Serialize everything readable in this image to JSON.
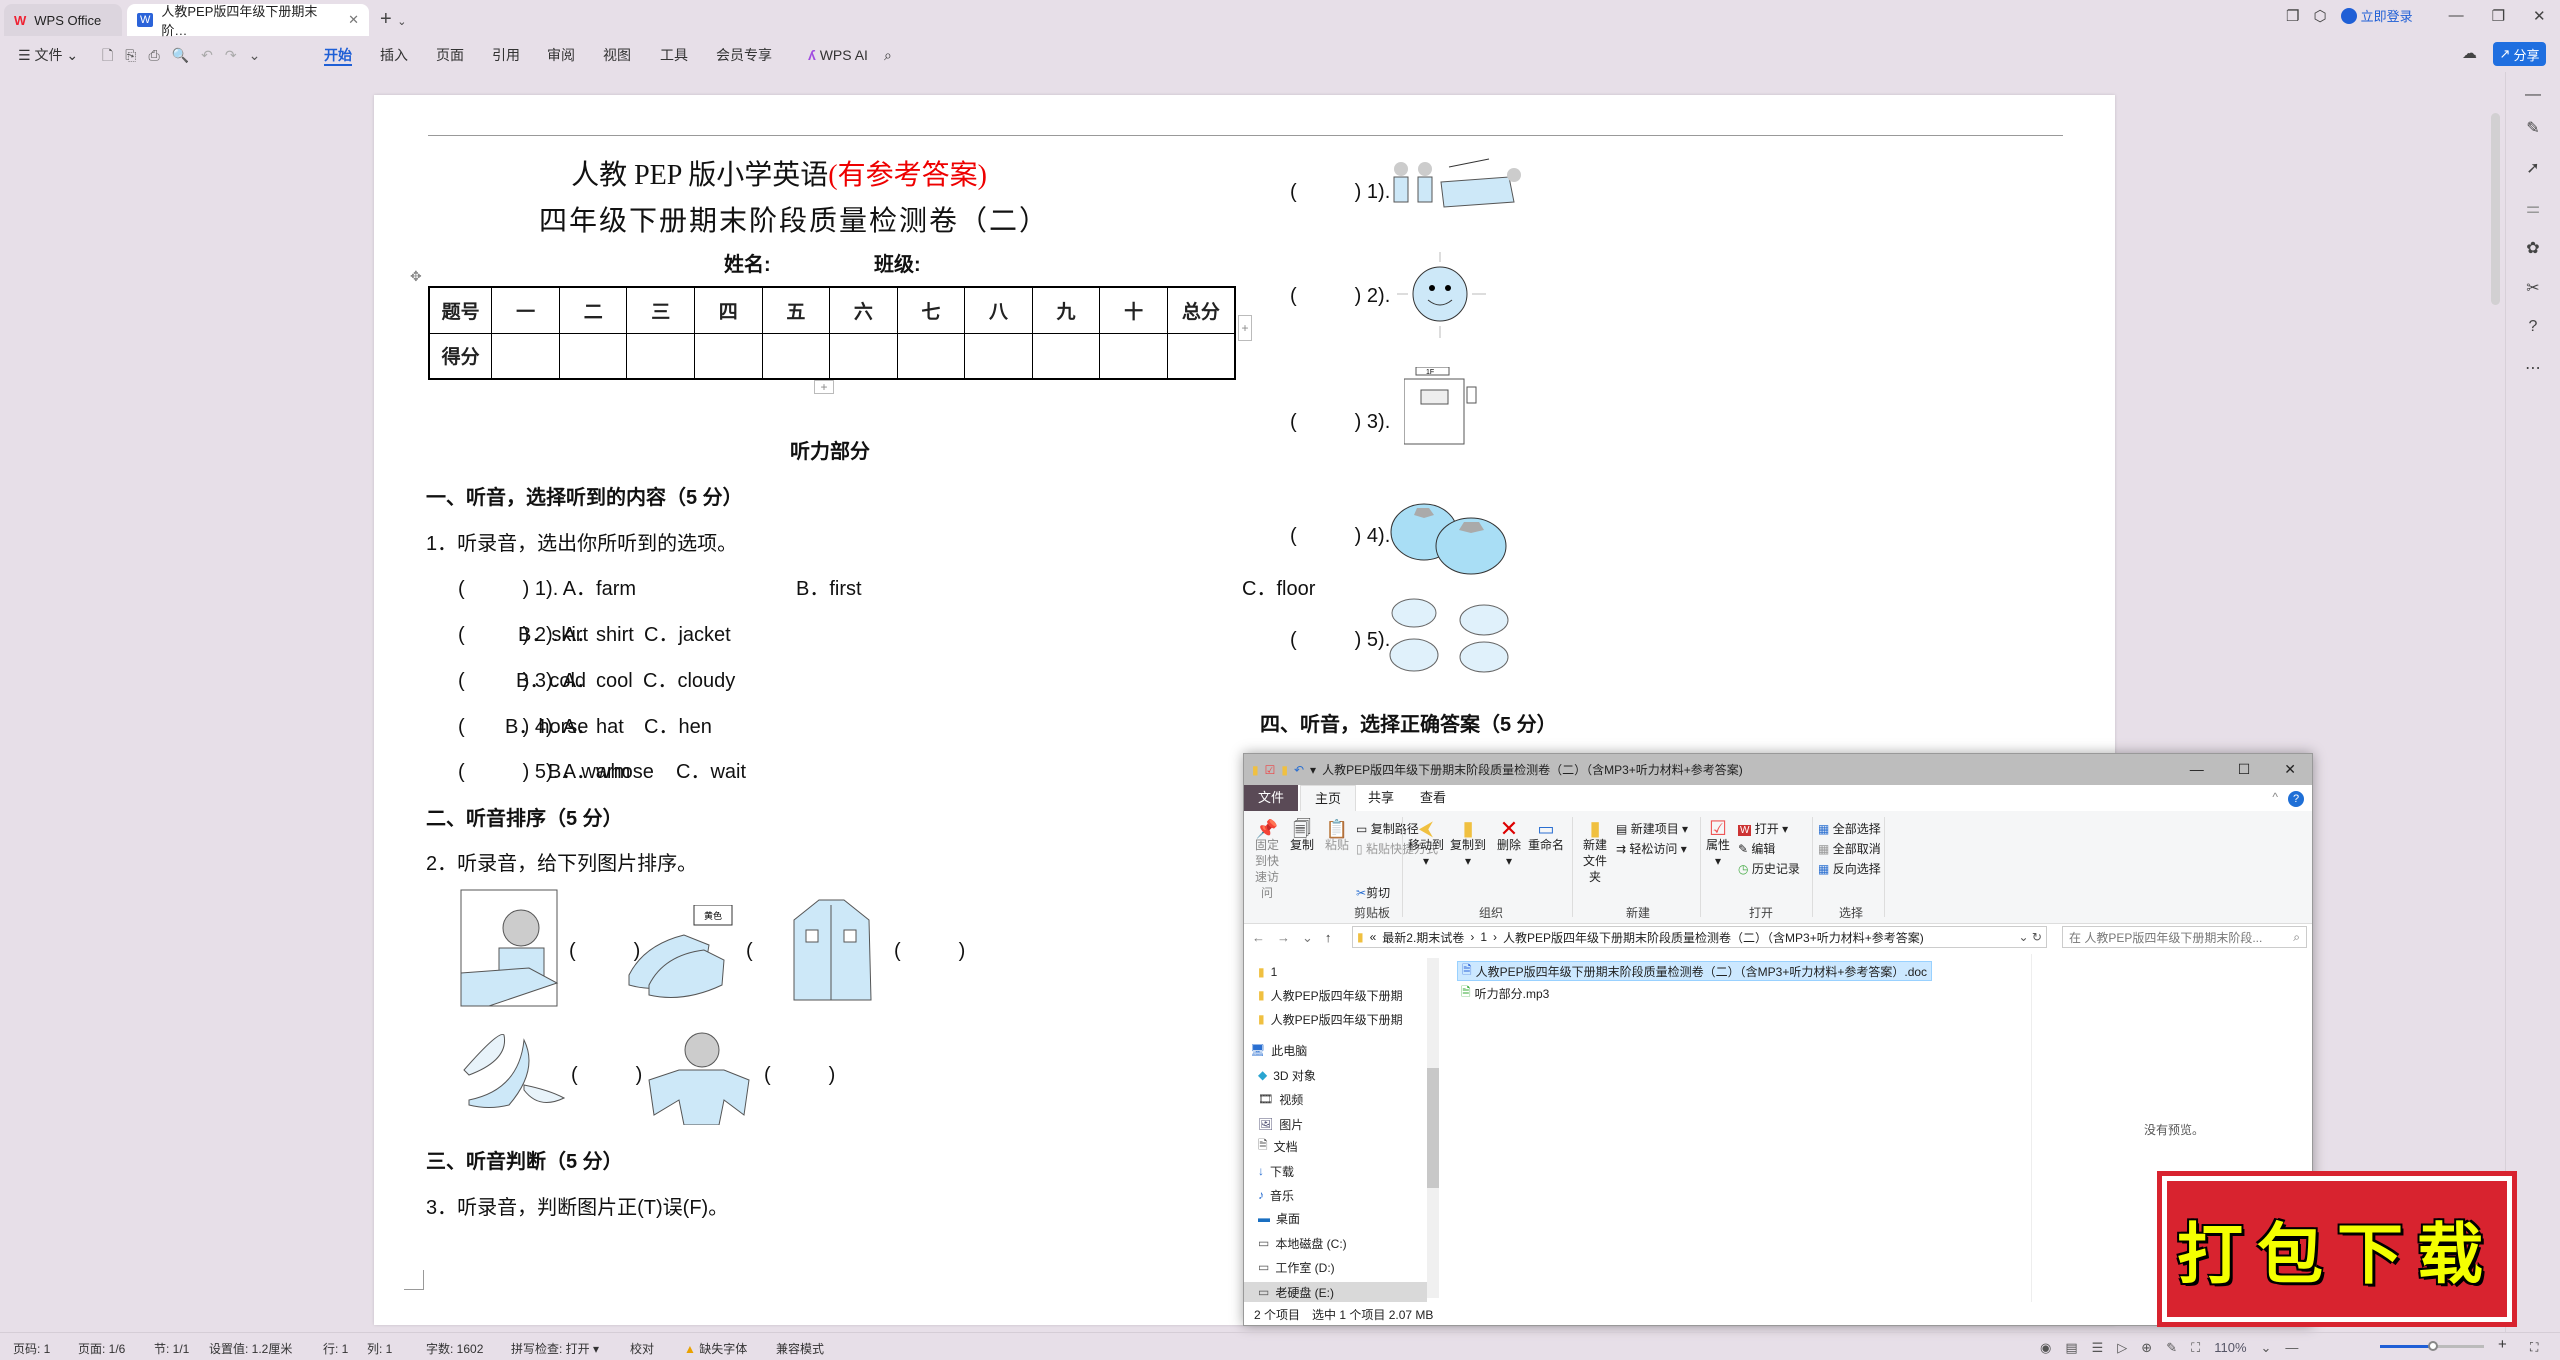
{
  "app": {
    "home_tab": "WPS Office",
    "doc_tab": "人教PEP版四年级下册期末阶…",
    "login": "立即登录",
    "share": "分享"
  },
  "menu": {
    "file": "文件",
    "tabs": [
      "开始",
      "插入",
      "页面",
      "引用",
      "审阅",
      "视图",
      "工具",
      "会员专享"
    ],
    "ai": "WPS AI",
    "active": "开始",
    "accent": "#1f5fd6"
  },
  "doc": {
    "title1": "人教 PEP 版小学英语",
    "title1_red": "(有参考答案)",
    "title2": "四年级下册期末阶段质量检测卷（二）",
    "name_label": "姓名:",
    "class_label": "班级:",
    "table_header": [
      "题号",
      "一",
      "二",
      "三",
      "四",
      "五",
      "六",
      "七",
      "八",
      "九",
      "十",
      "总分"
    ],
    "table_row2": "得分",
    "listening": "听力部分",
    "s1": "一、听音，选择听到的内容（5 分）",
    "q1": "1．听录音，选出你所听到的选项。",
    "q1_items": [
      {
        "n": "1). A．farm",
        "b": "B．first",
        "c": "C．floor"
      },
      {
        "n": "2). A．shirt",
        "b": "B．skirt",
        "c": "C．jacket"
      },
      {
        "n": "3). A．cool",
        "b": "B．cold",
        "c": "C．cloudy"
      },
      {
        "n": "4). A．hat",
        "b": "B．horse",
        "c": "C．hen"
      },
      {
        "n": "5). A．whose",
        "b": "B．warm",
        "c": "C．wait"
      }
    ],
    "s2": "二、听音排序（5 分）",
    "q2": "2．听录音，给下列图片排序。",
    "shoe_tag": "黄色",
    "s3": "三、听音判断（5 分）",
    "q3": "3．听录音，判断图片正(T)误(F)。",
    "right_items": [
      "1).",
      "2).",
      "3).",
      "4).",
      "5)."
    ],
    "elevator_sign": "1F",
    "s4": "四、听音，选择正确答案（5 分）",
    "paren_open": "(",
    "paren_close": ")"
  },
  "explorer": {
    "title": "人教PEP版四年级下册期末阶段质量检测卷（二）（含MP3+听力材料+参考答案)",
    "tabs": [
      "文件",
      "主页",
      "共享",
      "查看"
    ],
    "ribbon": {
      "pin": "固定到快速访问",
      "copy": "复制",
      "paste": "粘贴",
      "copy_path": "复制路径",
      "paste_shortcut": "粘贴快捷方式",
      "cut": "剪切",
      "clipboard": "剪贴板",
      "move_to": "移动到",
      "copy_to": "复制到",
      "delete": "删除",
      "rename": "重命名",
      "organize": "组织",
      "new_folder": "新建文件夹",
      "new_item": "新建项目",
      "easy_access": "轻松访问",
      "new": "新建",
      "properties": "属性",
      "open": "打开",
      "edit": "编辑",
      "history": "历史记录",
      "open_group": "打开",
      "select_all": "全部选择",
      "select_none": "全部取消",
      "invert": "反向选择",
      "select": "选择"
    },
    "breadcrumb": [
      "«",
      "最新2.期末试卷",
      "›",
      "1",
      "›",
      "人教PEP版四年级下册期末阶段质量检测卷（二）（含MP3+听力材料+参考答案)"
    ],
    "search_placeholder": "在 人教PEP版四年级下册期末阶段...",
    "nav": [
      "1",
      "人教PEP版四年级下册期",
      "人教PEP版四年级下册期",
      "此电脑",
      "3D 对象",
      "视频",
      "图片",
      "文档",
      "下载",
      "音乐",
      "桌面",
      "本地磁盘 (C:)",
      "工作室 (D:)",
      "老硬盘 (E:)"
    ],
    "files": [
      "人教PEP版四年级下册期末阶段质量检测卷（二）（含MP3+听力材料+参考答案）.doc",
      "听力部分.mp3"
    ],
    "no_preview": "没有预览。",
    "status": {
      "count": "2 个项目",
      "selected": "选中 1 个项目",
      "size": "2.07 MB"
    }
  },
  "stamp": "打包下载",
  "status": {
    "page": "页码: 1",
    "pages": "页面: 1/6",
    "section": "节: 1/1",
    "setting": "设置值: 1.2厘米",
    "row": "行: 1",
    "col": "列: 1",
    "words": "字数: 1602",
    "spell": "拼写检查: 打开 ▾",
    "proof": "校对",
    "missing_font": "缺失字体",
    "compat": "兼容模式",
    "zoom": "110%",
    "zoom_level": 110
  }
}
